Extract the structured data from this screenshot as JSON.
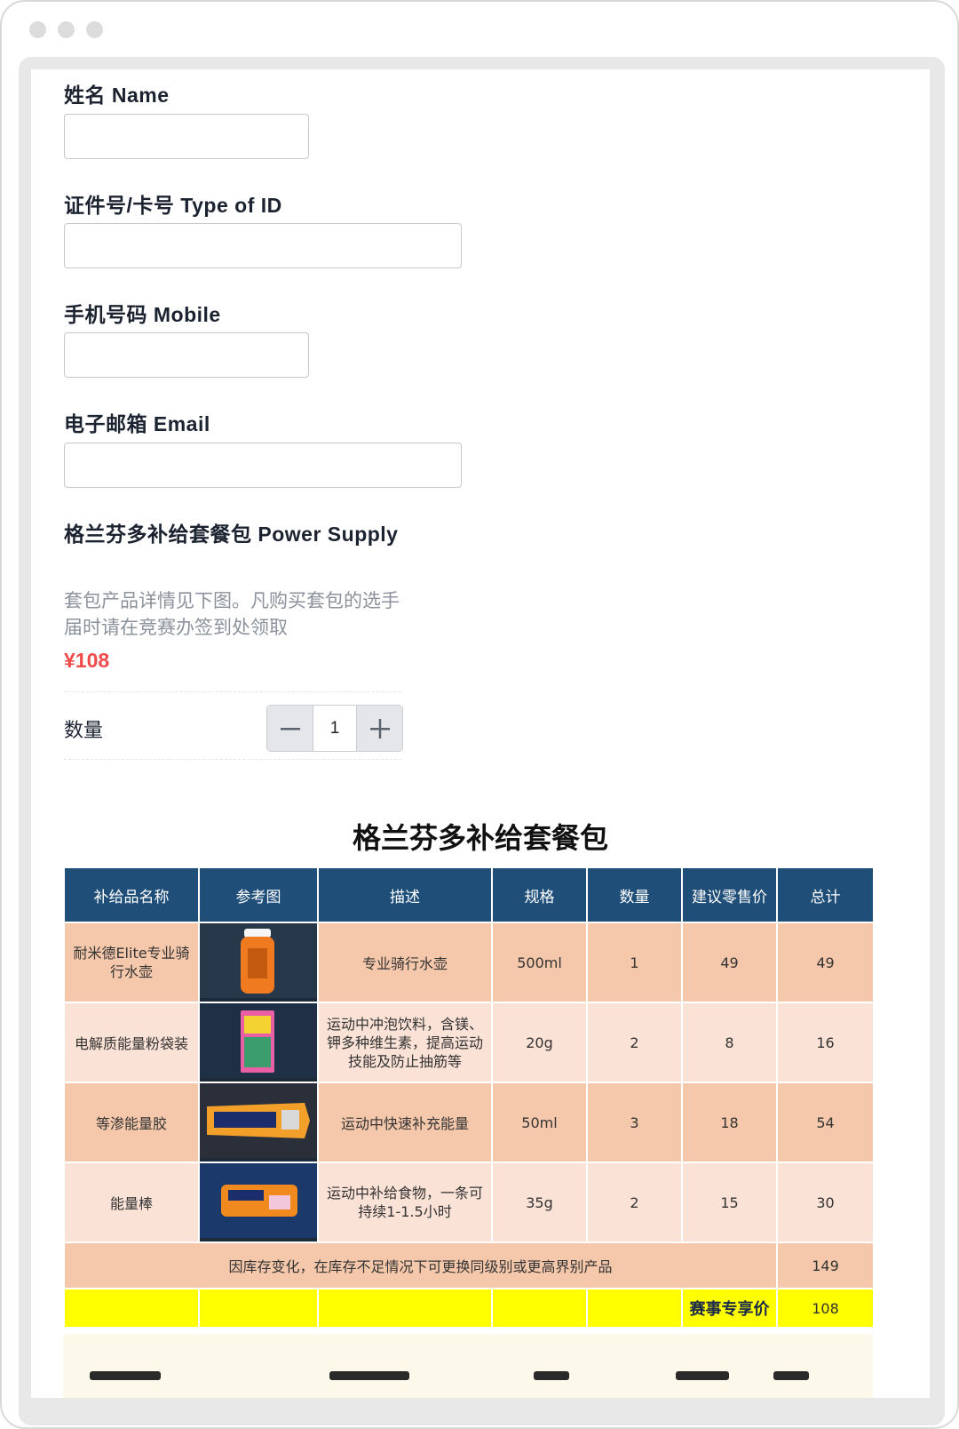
{
  "form": {
    "name_label": "姓名 Name",
    "name_value": "",
    "id_label": "证件号/卡号 Type of ID",
    "id_value": "",
    "mobile_label": "手机号码 Mobile",
    "mobile_value": "",
    "email_label": "电子邮箱 Email",
    "email_value": ""
  },
  "product": {
    "title": "格兰芬多补给套餐包 Power Supply",
    "description": "套包产品详情见下图。凡购买套包的选手届时请在竞赛办签到处领取",
    "price": "¥108",
    "quantity_label": "数量",
    "quantity": "1"
  },
  "package": {
    "title": "格兰芬多补给套餐包",
    "headers": [
      "补给品名称",
      "参考图",
      "描述",
      "规格",
      "数量",
      "建议零售价",
      "总计"
    ],
    "rows": [
      {
        "name": "耐米德Elite专业骑行水壶",
        "image": "water-bottle-image",
        "desc": "专业骑行水壶",
        "spec": "500ml",
        "qty": "1",
        "price": "49",
        "total": "49"
      },
      {
        "name": "电解质能量粉袋装",
        "image": "energy-powder-image",
        "desc": "运动中冲泡饮料，含镁、钾多种维生素，提高运动技能及防止抽筋等",
        "spec": "20g",
        "qty": "2",
        "price": "8",
        "total": "16"
      },
      {
        "name": "等渗能量胶",
        "image": "energy-gel-image",
        "desc": "运动中快速补充能量",
        "spec": "50ml",
        "qty": "3",
        "price": "18",
        "total": "54"
      },
      {
        "name": "能量棒",
        "image": "energy-bar-image",
        "desc": "运动中补给食物，一条可持续1-1.5小时",
        "spec": "35g",
        "qty": "2",
        "price": "15",
        "total": "30"
      }
    ],
    "note": "因库存变化，在库存不足情况下可更换同级别或更高界别产品",
    "sum_total": "149",
    "special_label": "赛事专享价",
    "special_price": "108"
  },
  "colors": {
    "header_bg": "#1f4e79",
    "row_dark": "#f6c8ab",
    "row_light": "#fbe2d6",
    "highlight": "#ffff00",
    "price": "#f04b4b"
  }
}
